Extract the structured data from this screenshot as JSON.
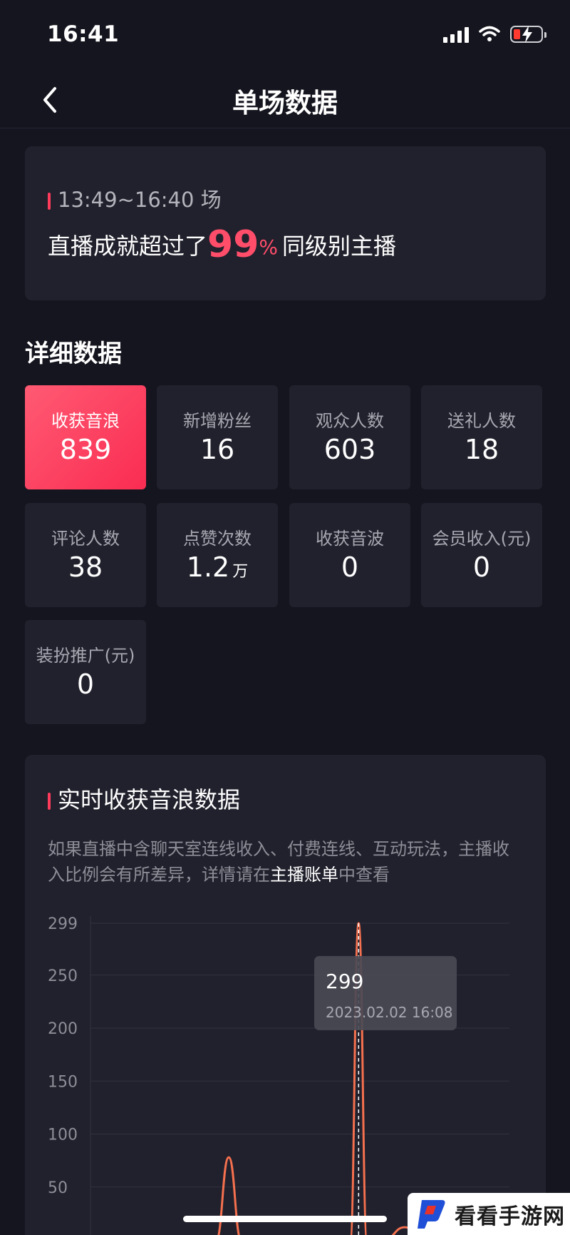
{
  "status_bar": {
    "time": "16:41"
  },
  "nav": {
    "title": "单场数据"
  },
  "summary": {
    "session": "13:49~16:40 场",
    "achieve_prefix": "直播成就超过了",
    "percent": "99",
    "percent_sign": "%",
    "achieve_suffix": "同级别主播"
  },
  "details": {
    "title": "详细数据",
    "stats": [
      {
        "label": "收获音浪",
        "value": "839",
        "unit": "",
        "active": true
      },
      {
        "label": "新增粉丝",
        "value": "16",
        "unit": ""
      },
      {
        "label": "观众人数",
        "value": "603",
        "unit": ""
      },
      {
        "label": "送礼人数",
        "value": "18",
        "unit": ""
      },
      {
        "label": "评论人数",
        "value": "38",
        "unit": ""
      },
      {
        "label": "点赞次数",
        "value": "1.2",
        "unit": "万"
      },
      {
        "label": "收获音波",
        "value": "0",
        "unit": ""
      },
      {
        "label": "会员收入(元)",
        "value": "0",
        "unit": ""
      },
      {
        "label": "装扮推广(元)",
        "value": "0",
        "unit": ""
      }
    ]
  },
  "realtime": {
    "title": "实时收获音浪数据",
    "note_prefix": "如果直播中含聊天室连线收入、付费连线、互动玩法，主播收入比例会有所差异，详情请在",
    "note_link": "主播账单",
    "note_suffix": "中查看",
    "tooltip": {
      "value": "299",
      "time": "2023.02.02 16:08"
    }
  },
  "chart_data": {
    "type": "line",
    "title": "实时收获音浪数据",
    "xlabel": "",
    "ylabel": "",
    "ylim": [
      0,
      299
    ],
    "yticks": [
      299,
      250,
      200,
      150,
      100,
      50
    ],
    "grid": true,
    "series": [
      {
        "color": "#f5704e",
        "x": [
          0,
          0.2,
          0.3,
          0.33,
          0.36,
          0.4,
          0.5,
          0.58,
          0.62,
          0.64,
          0.66,
          0.7,
          0.75,
          0.8,
          0.85,
          0.9,
          1.0
        ],
        "values": [
          0,
          0,
          0,
          78,
          0,
          0,
          0,
          0,
          0,
          299,
          0,
          0,
          12,
          0,
          12,
          0,
          0
        ]
      }
    ],
    "highlight": {
      "value": 299,
      "label": "2023.02.02 16:08"
    },
    "line_color": "#f5704e",
    "grid_color": "#33333f"
  },
  "watermark": {
    "text": "看看手游网"
  }
}
